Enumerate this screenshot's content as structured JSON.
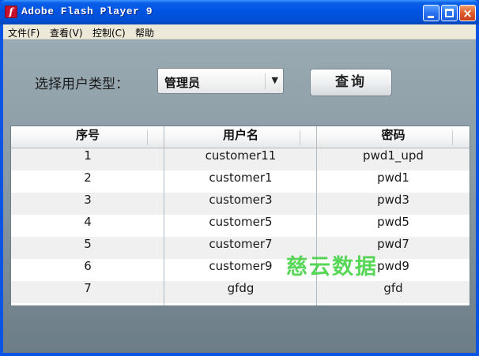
{
  "window": {
    "title": "Adobe Flash Player 9",
    "icon": "flash-player-icon",
    "controls": {
      "minimize": "minimize-icon",
      "maximize": "maximize-icon",
      "close": "×"
    }
  },
  "menu": {
    "items": [
      {
        "label": "文件(F)"
      },
      {
        "label": "查看(V)"
      },
      {
        "label": "控制(C)"
      },
      {
        "label": "帮助"
      }
    ]
  },
  "form": {
    "user_type_label": "选择用户类型：",
    "user_type_value": "管理员",
    "dropdown_arrow": "▼",
    "query_button": "查询"
  },
  "grid": {
    "columns": [
      "序号",
      "用户名",
      "密码"
    ],
    "rows": [
      [
        "1",
        "customer11",
        "pwd1_upd"
      ],
      [
        "2",
        "customer1",
        "pwd1"
      ],
      [
        "3",
        "customer3",
        "pwd3"
      ],
      [
        "4",
        "customer5",
        "pwd5"
      ],
      [
        "5",
        "customer7",
        "pwd7"
      ],
      [
        "6",
        "customer9",
        "pwd9"
      ],
      [
        "7",
        "gfdg",
        "gfd"
      ]
    ]
  },
  "watermark": "慈云数据",
  "colors": {
    "titlebar": "#0054e3",
    "content_background": "#8a9aa4",
    "watermark": "#3ccf3c"
  }
}
